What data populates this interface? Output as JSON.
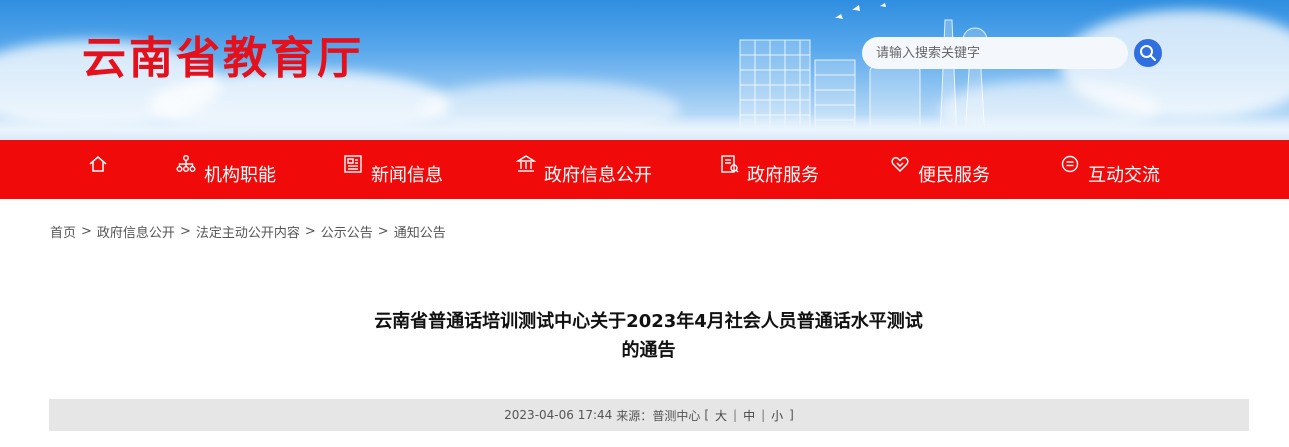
{
  "header": {
    "site_title": "云南省教育厅",
    "search": {
      "placeholder": "请输入搜索关键字"
    }
  },
  "nav": {
    "items": [
      {
        "label": "",
        "icon": "home-icon"
      },
      {
        "label": "机构职能",
        "icon": "org-chart-icon"
      },
      {
        "label": "新闻信息",
        "icon": "news-icon"
      },
      {
        "label": "政府信息公开",
        "icon": "government-building-icon"
      },
      {
        "label": "政府服务",
        "icon": "service-document-icon"
      },
      {
        "label": "便民服务",
        "icon": "handshake-icon"
      },
      {
        "label": "互动交流",
        "icon": "chat-icon"
      }
    ]
  },
  "breadcrumb": {
    "items": [
      "首页",
      "政府信息公开",
      "法定主动公开内容",
      "公示公告",
      "通知公告"
    ],
    "separator": ">"
  },
  "article": {
    "title_line1": "云南省普通话培训测试中心关于2023年4月社会人员普通话水平测试",
    "title_line2": "的通告",
    "meta": {
      "datetime": "2023-04-06 17:44",
      "source_label": "来源：",
      "source": "普测中心",
      "font_sizes": [
        "大",
        "中",
        "小"
      ]
    }
  },
  "colors": {
    "title_red": "#e4111d",
    "nav_red": "#f00a0a",
    "search_button_blue": "#2f6fe0",
    "meta_bar_gray": "#e6e6e6"
  }
}
